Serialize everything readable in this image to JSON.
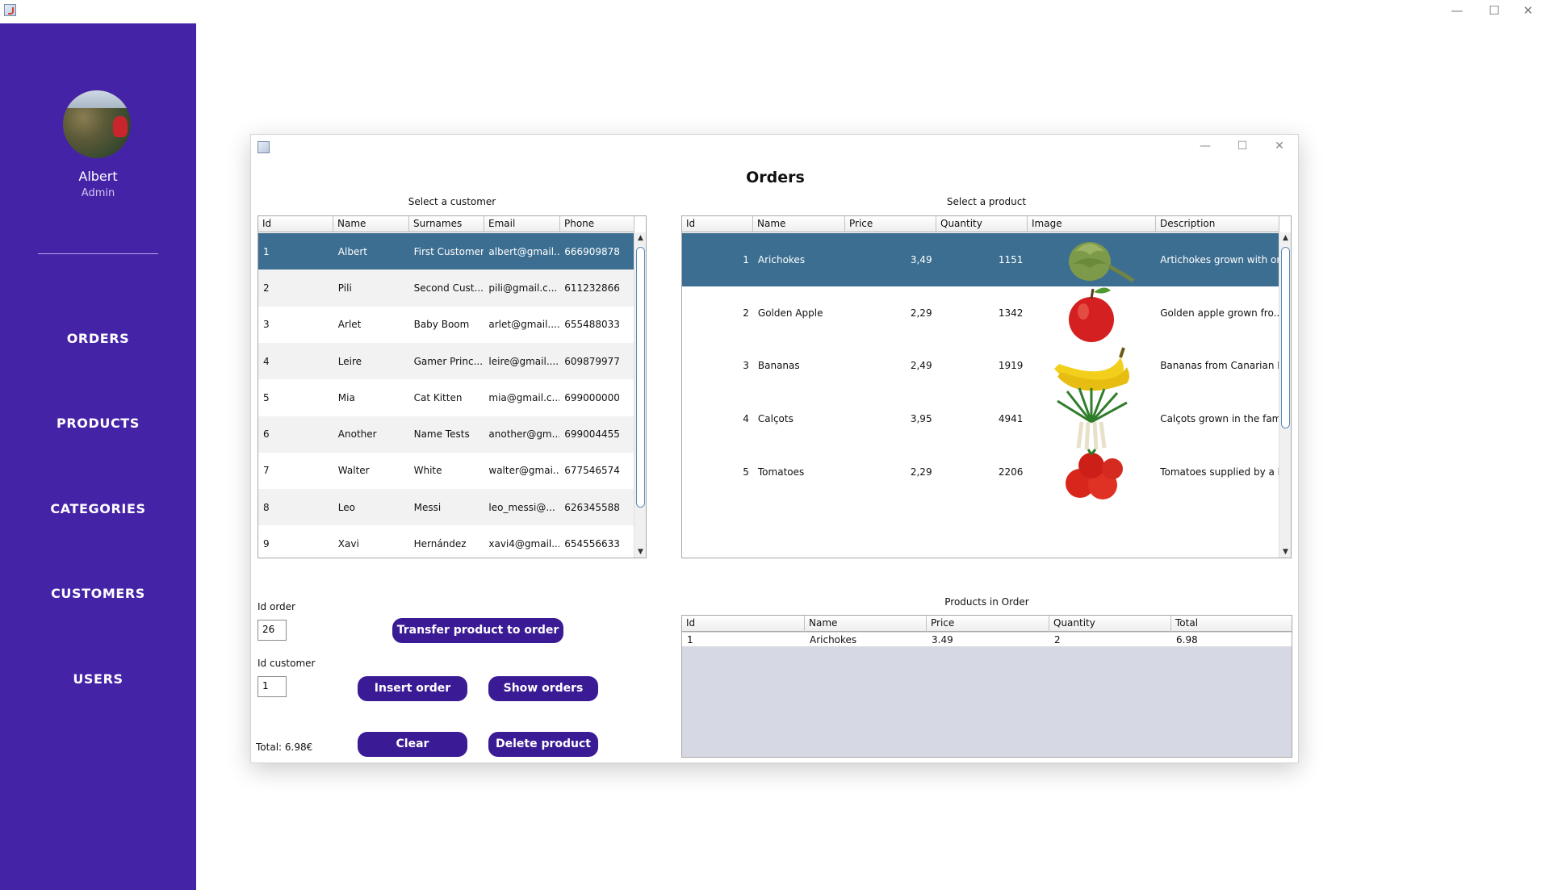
{
  "sidebar": {
    "user_name": "Albert",
    "user_role": "Admin",
    "nav": [
      "ORDERS",
      "PRODUCTS",
      "CATEGORIES",
      "CUSTOMERS",
      "USERS"
    ]
  },
  "dialog": {
    "title": "Orders",
    "customer_caption": "Select a customer",
    "product_caption": "Select a product",
    "order_caption": "Products in Order"
  },
  "customers": {
    "columns": [
      "Id",
      "Name",
      "Surnames",
      "Email",
      "Phone"
    ],
    "rows": [
      [
        "1",
        "Albert",
        "First Customer",
        "albert@gmail....",
        "666909878"
      ],
      [
        "2",
        "Pili",
        "Second Cust...",
        "pili@gmail.c...",
        "611232866"
      ],
      [
        "3",
        "Arlet",
        "Baby Boom",
        "arlet@gmail....",
        "655488033"
      ],
      [
        "4",
        "Leire",
        "Gamer Princ...",
        "leire@gmail....",
        "609879977"
      ],
      [
        "5",
        "Mia",
        "Cat Kitten",
        "mia@gmail.c...",
        "699000000"
      ],
      [
        "6",
        "Another",
        "Name Tests",
        "another@gm...",
        "699004455"
      ],
      [
        "7",
        "Walter",
        "White",
        "walter@gmai...",
        "677546574"
      ],
      [
        "8",
        "Leo",
        "Messi",
        "leo_messi@...",
        "626345588"
      ],
      [
        "9",
        "Xavi",
        "Hernández",
        "xavi4@gmail....",
        "654556633"
      ]
    ]
  },
  "products": {
    "columns": [
      "Id",
      "Name",
      "Price",
      "Quantity",
      "Image",
      "Description"
    ],
    "rows": [
      [
        "1",
        "Arichokes",
        "3,49",
        "1151",
        "artichoke-image",
        "Artichokes grown with or..."
      ],
      [
        "2",
        "Golden Apple",
        "2,29",
        "1342",
        "apple-image",
        "Golden apple grown fro..."
      ],
      [
        "3",
        "Bananas",
        "2,49",
        "1919",
        "banana-image",
        "Bananas from Canarian I..."
      ],
      [
        "4",
        "Calçots",
        "3,95",
        "4941",
        "calcots-image",
        "Calçots grown in the fam..."
      ],
      [
        "5",
        "Tomatoes",
        "2,29",
        "2206",
        "tomato-image",
        "Tomatoes supplied by a l..."
      ]
    ]
  },
  "order_items": {
    "columns": [
      "Id",
      "Name",
      "Price",
      "Quantity",
      "Total"
    ],
    "rows": [
      [
        "1",
        "Arichokes",
        "3.49",
        "2",
        "6.98"
      ]
    ]
  },
  "form": {
    "id_order_label": "Id order",
    "id_order_value": "26",
    "id_customer_label": "Id customer",
    "id_customer_value": "1",
    "total_text": "Total: 6.98€",
    "transfer_button": "Transfer product to order",
    "insert_button": "Insert order",
    "show_button": "Show orders",
    "clear_button": "Clear",
    "delete_button": "Delete product"
  },
  "colors": {
    "sidebar": "#4523a6",
    "button": "#3a1a95",
    "selection": "#3c6e91",
    "empty_table_area": "#d6d9e3"
  }
}
